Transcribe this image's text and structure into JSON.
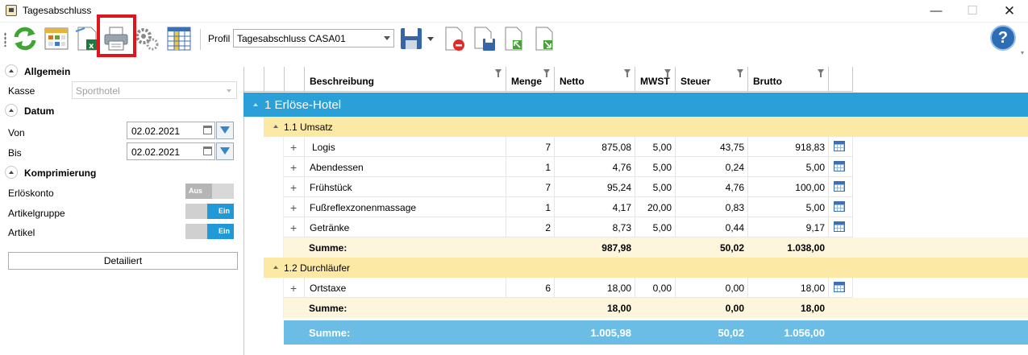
{
  "window": {
    "title": "Tagesabschluss",
    "minimize": "—",
    "maximize": "☐",
    "close": "✕"
  },
  "toolbar": {
    "buttons": [
      "refresh-icon",
      "calendar-grid-icon",
      "excel-export-icon",
      "print-icon",
      "settings-gear-icon",
      "table-layout-icon",
      "save-icon",
      "delete-document-icon",
      "save-as-icon",
      "export-green-icon",
      "import-green-icon",
      "help-icon"
    ],
    "profil_label": "Profil",
    "profil_value": "Tagesabschluss CASA01",
    "help": "?",
    "highlight_color": "#e0141c"
  },
  "filters": {
    "allgemein": "Allgemein",
    "kasse_label": "Kasse",
    "kasse_value": "Sporthotel",
    "datum": "Datum",
    "von_label": "Von",
    "von_value": "02.02.2021",
    "bis_label": "Bis",
    "bis_value": "02.02.2021",
    "komprimierung": "Komprimierung",
    "erloeskonto_label": "Erlöskonto",
    "erloeskonto_value": "Aus",
    "artikelgruppe_label": "Artikelgruppe",
    "artikelgruppe_value": "Ein",
    "artikel_label": "Artikel",
    "artikel_value": "Ein",
    "detail_button": "Detailiert"
  },
  "grid": {
    "columns": {
      "beschreibung": "Beschreibung",
      "menge": "Menge",
      "netto": "Netto",
      "mwst": "MWST",
      "steuer": "Steuer",
      "brutto": "Brutto"
    },
    "group1": "1 Erlöse-Hotel",
    "sub1": "1.1 Umsatz",
    "sub1_rows": [
      {
        "beschreibung": "Logis",
        "menge": "7",
        "netto": "875,08",
        "mwst": "5,00",
        "steuer": "43,75",
        "brutto": "918,83"
      },
      {
        "beschreibung": "Abendessen",
        "menge": "1",
        "netto": "4,76",
        "mwst": "5,00",
        "steuer": "0,24",
        "brutto": "5,00"
      },
      {
        "beschreibung": "Frühstück",
        "menge": "7",
        "netto": "95,24",
        "mwst": "5,00",
        "steuer": "4,76",
        "brutto": "100,00"
      },
      {
        "beschreibung": "Fußreflexzonenmassage",
        "menge": "1",
        "netto": "4,17",
        "mwst": "20,00",
        "steuer": "0,83",
        "brutto": "5,00"
      },
      {
        "beschreibung": "Getränke",
        "menge": "2",
        "netto": "8,73",
        "mwst": "5,00",
        "steuer": "0,44",
        "brutto": "9,17"
      }
    ],
    "sub1_sum": {
      "label": "Summe:",
      "netto": "987,98",
      "steuer": "50,02",
      "brutto": "1.038,00"
    },
    "sub2": "1.2 Durchläufer",
    "sub2_rows": [
      {
        "beschreibung": "Ortstaxe",
        "menge": "6",
        "netto": "18,00",
        "mwst": "0,00",
        "steuer": "0,00",
        "brutto": "18,00"
      }
    ],
    "sub2_sum": {
      "label": "Summe:",
      "netto": "18,00",
      "steuer": "0,00",
      "brutto": "18,00"
    },
    "total": {
      "label": "Summe:",
      "netto": "1.005,98",
      "steuer": "50,02",
      "brutto": "1.056,00"
    },
    "colors": {
      "group": "#2a9fd8",
      "subgroup": "#fde9a6",
      "sum": "#fef6dc",
      "total": "#6cbde6"
    }
  }
}
